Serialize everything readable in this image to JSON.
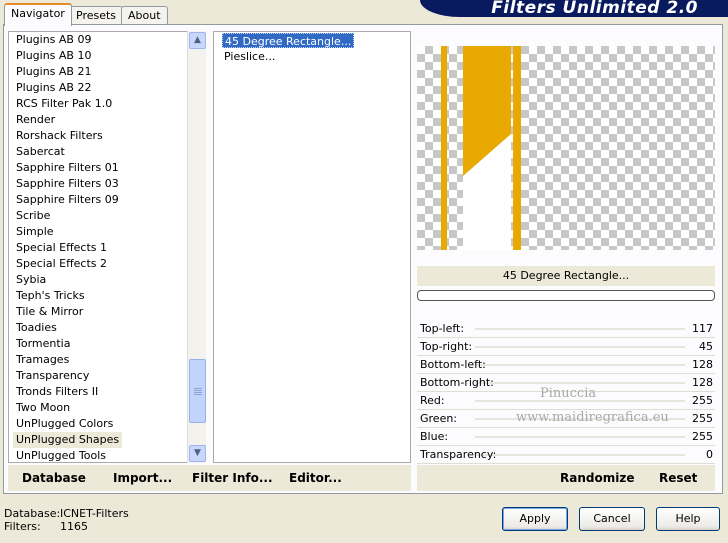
{
  "banner": {
    "title": "Filters Unlimited 2.0"
  },
  "tabs": [
    {
      "label": "Navigator",
      "active": true
    },
    {
      "label": "Presets",
      "active": false
    },
    {
      "label": "About",
      "active": false
    }
  ],
  "categories": [
    "Plugins AB 09",
    "Plugins AB 10",
    "Plugins AB 21",
    "Plugins AB 22",
    "RCS Filter Pak 1.0",
    "Render",
    "Rorshack Filters",
    "Sabercat",
    "Sapphire Filters 01",
    "Sapphire Filters 03",
    "Sapphire Filters 09",
    "Scribe",
    "Simple",
    "Special Effects 1",
    "Special Effects 2",
    "Sybia",
    "Teph's Tricks",
    "Tile & Mirror",
    "Toadies",
    "Tormentia",
    "Tramages",
    "Transparency",
    "Tronds Filters II",
    "Two Moon",
    "UnPlugged Colors",
    "UnPlugged Shapes",
    "UnPlugged Tools"
  ],
  "selected_category": "UnPlugged Shapes",
  "filters": [
    "45 Degree Rectangle...",
    "Pieslice..."
  ],
  "selected_filter": "45 Degree Rectangle...",
  "preview": {
    "label": "45 Degree Rectangle...",
    "stripe_color": "#e8a900"
  },
  "params": [
    {
      "label": "Top-left:",
      "value": "117"
    },
    {
      "label": "Top-right:",
      "value": "45"
    },
    {
      "label": "Bottom-left:",
      "value": "128"
    },
    {
      "label": "Bottom-right:",
      "value": "128"
    },
    {
      "label": "Red:",
      "value": "255"
    },
    {
      "label": "Green:",
      "value": "255"
    },
    {
      "label": "Blue:",
      "value": "255"
    },
    {
      "label": "Transparency:",
      "value": "0"
    }
  ],
  "watermark": {
    "line1": "Pinuccia",
    "line2": "www.maidiregrafica.eu"
  },
  "left_toolbar": {
    "database": "Database",
    "import": "Import...",
    "filter_info": "Filter Info...",
    "editor": "Editor..."
  },
  "right_toolbar": {
    "randomize": "Randomize",
    "reset": "Reset"
  },
  "status": {
    "database_label": "Database:",
    "database_value": "ICNET-Filters",
    "filters_label": "Filters:",
    "filters_value": "1165"
  },
  "buttons": {
    "apply": "Apply",
    "cancel": "Cancel",
    "help": "Help"
  }
}
